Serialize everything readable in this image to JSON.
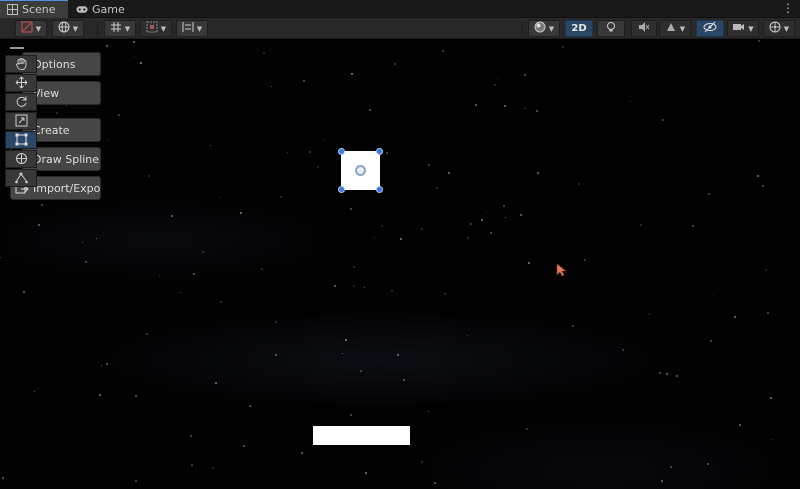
{
  "tabs": [
    {
      "label": "Scene",
      "icon": "grid-icon",
      "active": true
    },
    {
      "label": "Game",
      "icon": "gamepad-icon",
      "active": false
    }
  ],
  "tab_menu_glyph": "⋮",
  "toolbar": {
    "mode_2d_label": "2D",
    "mode_2d_active": true
  },
  "overlay_buttons": [
    {
      "label": "Options"
    },
    {
      "label": "View"
    },
    {
      "label": "Create"
    },
    {
      "label": "Draw Spline"
    },
    {
      "label": "Import/Export"
    }
  ],
  "tools": [
    {
      "name": "hand-tool",
      "icon": "hand-icon",
      "active": false
    },
    {
      "name": "move-tool",
      "icon": "move-icon",
      "active": false
    },
    {
      "name": "rotate-tool",
      "icon": "rotate-icon",
      "active": false
    },
    {
      "name": "scale-tool",
      "icon": "scale-icon",
      "active": false
    },
    {
      "name": "rect-tool",
      "icon": "rect-icon",
      "active": true
    },
    {
      "name": "transform-tool",
      "icon": "transform-icon",
      "active": false
    },
    {
      "name": "custom-tool",
      "icon": "spline-tool-icon",
      "active": false
    }
  ],
  "colors": {
    "accent": "#2a4866",
    "handle": "#3b78d8",
    "cursor": "#e0785a"
  }
}
